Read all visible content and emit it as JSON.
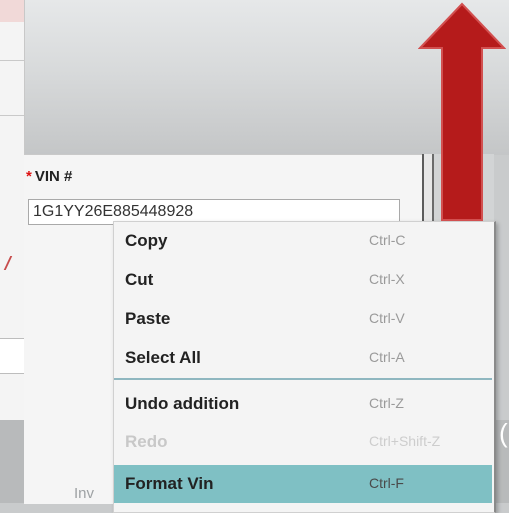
{
  "field": {
    "required_marker": "*",
    "label": "VIN #",
    "value": "1G1YY26E885448928"
  },
  "context_menu": {
    "items": [
      {
        "label": "Copy",
        "shortcut": "Ctrl-C"
      },
      {
        "label": "Cut",
        "shortcut": "Ctrl-X"
      },
      {
        "label": "Paste",
        "shortcut": "Ctrl-V"
      },
      {
        "label": "Select All",
        "shortcut": "Ctrl-A"
      },
      {
        "label": "Undo addition",
        "shortcut": "Ctrl-Z"
      },
      {
        "label": "Redo",
        "shortcut": "Ctrl+Shift-Z",
        "disabled": true
      },
      {
        "label": "Format Vin",
        "shortcut": "Ctrl-F",
        "highlighted": true
      }
    ]
  },
  "background": {
    "partial_label": "Inv",
    "edge_glyph": "("
  },
  "colors": {
    "arrow": "#b51b1b",
    "highlight": "#7fc0c4",
    "required": "#d11111"
  }
}
